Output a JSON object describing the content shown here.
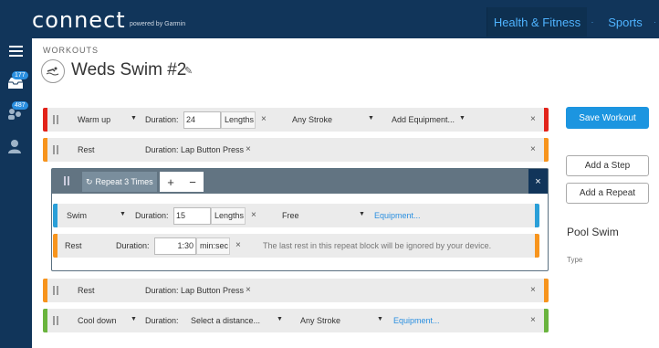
{
  "topbar": {
    "logo": "connect",
    "logo_sub": "powered by Garmin",
    "nav_health": "Health & Fitness",
    "nav_sports": "Sports",
    "nav_dot": "·"
  },
  "sidebar": {
    "badge_inbox": "177",
    "badge_connections": "487"
  },
  "header": {
    "section": "WORKOUTS",
    "title": "Weds Swim #2"
  },
  "steps": {
    "warmup": {
      "type": "Warm up",
      "duration_label": "Duration:",
      "duration_value": "24",
      "unit": "Lengths",
      "stroke": "Any Stroke",
      "equipment": "Add Equipment...",
      "color": "#e2231a"
    },
    "rest1": {
      "type": "Rest",
      "duration": "Duration: Lap Button Press",
      "color": "#f7941d"
    },
    "repeat": {
      "label": "Repeat 3 Times",
      "plus": "+",
      "minus": "−",
      "close": "×",
      "swim": {
        "type": "Swim",
        "duration_label": "Duration:",
        "duration_value": "15",
        "unit": "Lengths",
        "stroke": "Free",
        "equipment": "Equipment...",
        "color": "#2a9fd8"
      },
      "rest": {
        "type": "Rest",
        "duration_label": "Duration:",
        "duration_value": "1:30",
        "unit": "min:sec",
        "note": "The last rest in this repeat block will be ignored by your device.",
        "color": "#f7941d"
      }
    },
    "rest2": {
      "type": "Rest",
      "duration": "Duration: Lap Button Press",
      "color": "#f7941d"
    },
    "cooldown": {
      "type": "Cool down",
      "duration_label": "Duration:",
      "distance_placeholder": "Select a distance...",
      "stroke": "Any Stroke",
      "equipment": "Equipment...",
      "color": "#6ab43e"
    }
  },
  "panel": {
    "save": "Save Workout",
    "add_step": "Add a Step",
    "add_repeat": "Add a Repeat",
    "pool_title": "Pool Swim",
    "pool_type": "Type"
  },
  "icons": {
    "caret": "▼",
    "close": "×",
    "edit": "✎",
    "swim": "swim-icon"
  }
}
